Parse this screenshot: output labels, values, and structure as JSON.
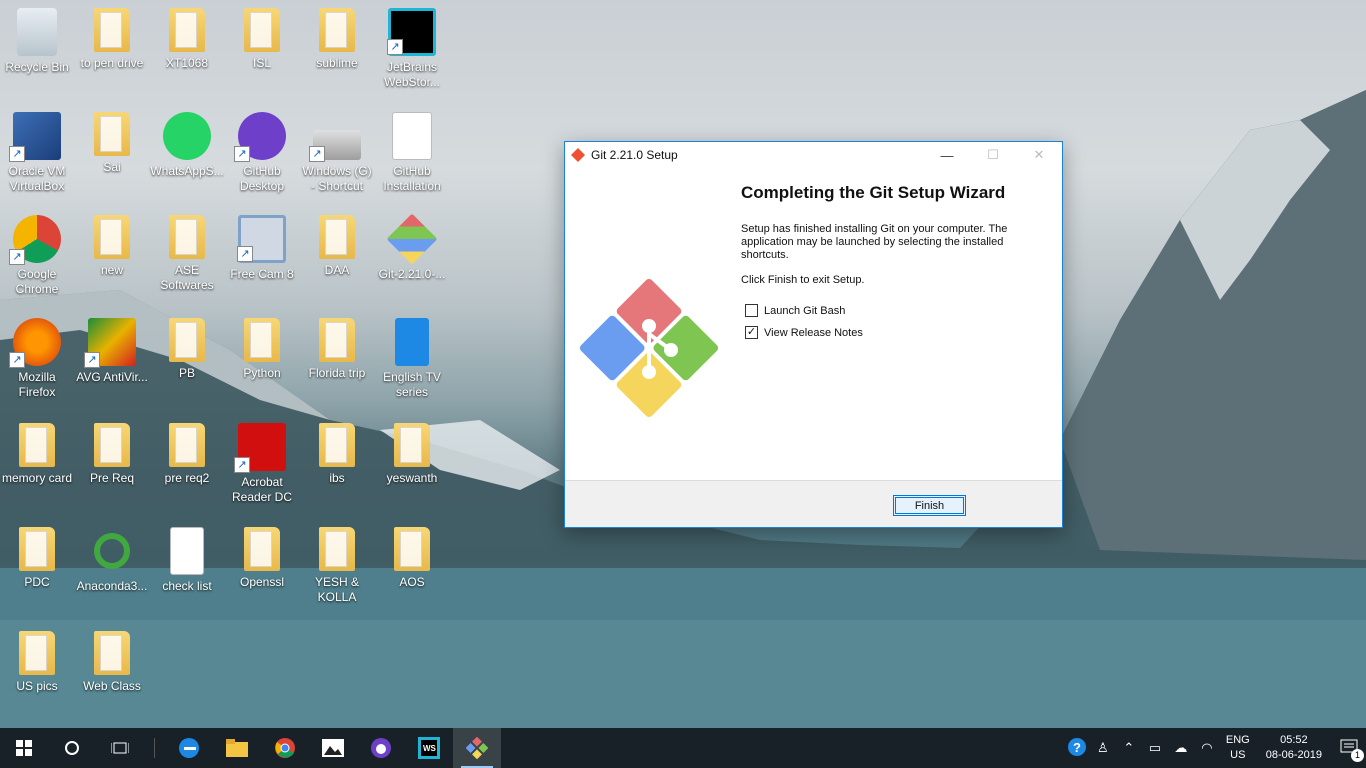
{
  "desktop": {
    "icons": [
      {
        "label": "Recycle Bin",
        "kind": "recycle"
      },
      {
        "label": "to pen drive",
        "kind": "folder"
      },
      {
        "label": "XT1068",
        "kind": "folder"
      },
      {
        "label": "ISL",
        "kind": "folder"
      },
      {
        "label": "sublime",
        "kind": "folder"
      },
      {
        "label": "JetBrains WebStor...",
        "kind": "webstorm"
      },
      {
        "label": "Oracle VM VirtualBox",
        "kind": "virtualbox"
      },
      {
        "label": "Sai",
        "kind": "folder"
      },
      {
        "label": "WhatsAppS...",
        "kind": "whatsapp"
      },
      {
        "label": "GitHub Desktop",
        "kind": "github"
      },
      {
        "label": "Windows (G) - Shortcut",
        "kind": "drive"
      },
      {
        "label": "GitHub Installation",
        "kind": "word"
      },
      {
        "label": "Google Chrome",
        "kind": "chrome"
      },
      {
        "label": "new",
        "kind": "folder"
      },
      {
        "label": "ASE Softwares",
        "kind": "folder"
      },
      {
        "label": "Free Cam 8",
        "kind": "freecam"
      },
      {
        "label": "DAA",
        "kind": "folder"
      },
      {
        "label": "Git-2.21.0-...",
        "kind": "git"
      },
      {
        "label": "Mozilla Firefox",
        "kind": "firefox"
      },
      {
        "label": "AVG AntiVir...",
        "kind": "avg"
      },
      {
        "label": "PB",
        "kind": "folder"
      },
      {
        "label": "Python",
        "kind": "folder"
      },
      {
        "label": "Florida trip",
        "kind": "folder"
      },
      {
        "label": "English TV series",
        "kind": "tvfolder"
      },
      {
        "label": "memory card",
        "kind": "folder"
      },
      {
        "label": "Pre Req",
        "kind": "folder"
      },
      {
        "label": "pre req2",
        "kind": "folder"
      },
      {
        "label": "Acrobat Reader DC",
        "kind": "acrobat"
      },
      {
        "label": "ibs",
        "kind": "folder"
      },
      {
        "label": "yeswanth",
        "kind": "folder"
      },
      {
        "label": "PDC",
        "kind": "folder"
      },
      {
        "label": "Anaconda3...",
        "kind": "anaconda"
      },
      {
        "label": "check list",
        "kind": "file"
      },
      {
        "label": "Openssl",
        "kind": "folder"
      },
      {
        "label": "YESH & KOLLA",
        "kind": "folder"
      },
      {
        "label": "AOS",
        "kind": "folder"
      },
      {
        "label": "US pics",
        "kind": "folder"
      },
      {
        "label": "Web Class",
        "kind": "folder"
      }
    ]
  },
  "window": {
    "title": "Git 2.21.0 Setup",
    "heading": "Completing the Git Setup Wizard",
    "paragraph1": "Setup has finished installing Git on your computer. The application may be launched by selecting the installed shortcuts.",
    "paragraph2": "Click Finish to exit Setup.",
    "launch_git_bash_label": "Launch Git Bash",
    "launch_git_bash_checked": false,
    "view_release_notes_label": "View Release Notes",
    "view_release_notes_checked": true,
    "finish_label": "Finish",
    "minimize_glyph": "—",
    "maximize_glyph": "☐",
    "close_glyph": "✕"
  },
  "taskbar": {
    "lang_top": "ENG",
    "lang_bottom": "US",
    "time": "05:52",
    "date": "08-06-2019",
    "notification_count": "1",
    "colors": {
      "accent": "#9ccaf0",
      "git_red": "#f05133"
    }
  }
}
